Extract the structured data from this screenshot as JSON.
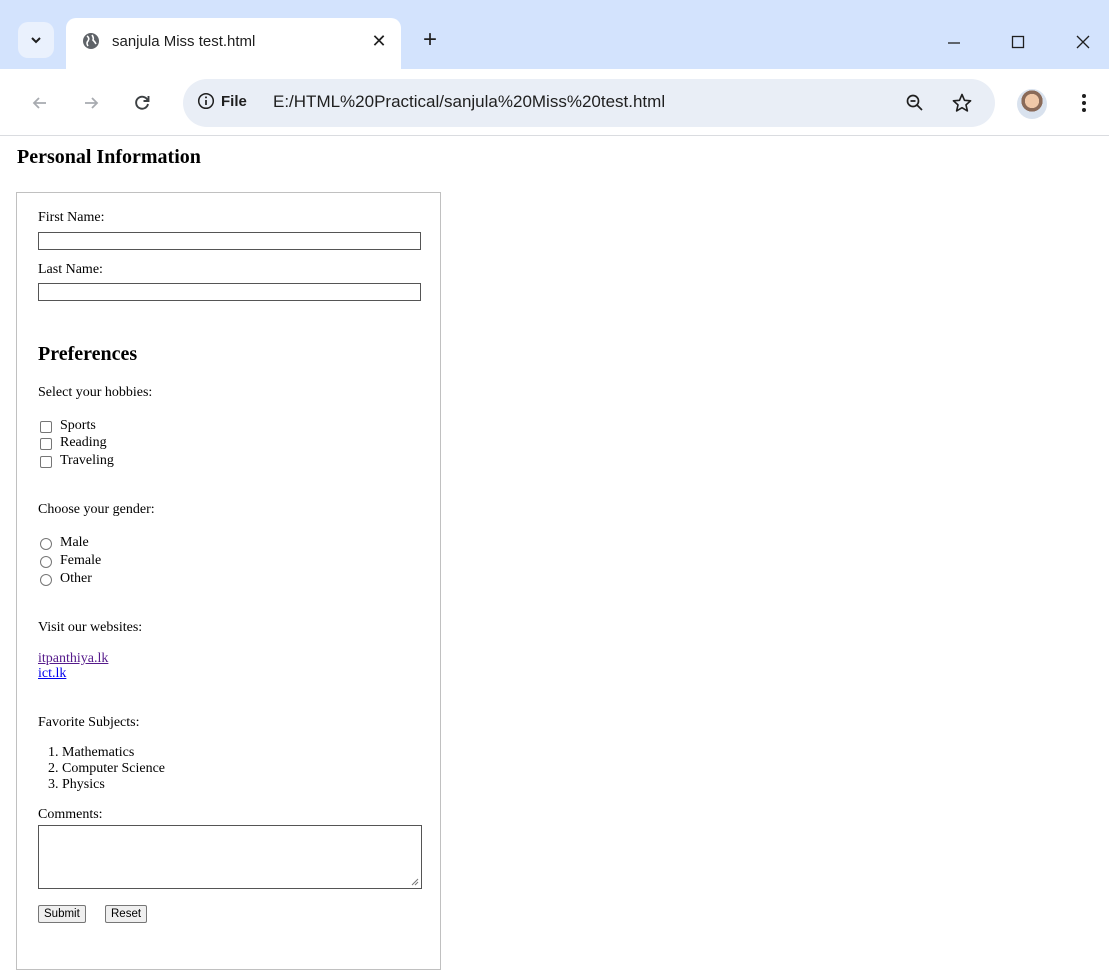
{
  "browser": {
    "tab": {
      "title": "sanjula Miss test.html",
      "close_glyph": "✕"
    },
    "new_tab_glyph": "+",
    "address": {
      "info_label": "File",
      "url": "E:/HTML%20Practical/sanjula%20Miss%20test.html"
    }
  },
  "page": {
    "heading": "Personal Information",
    "fields": {
      "first_name_label": "First Name:",
      "last_name_label": "Last Name:"
    },
    "preferences_heading": "Preferences",
    "hobbies": {
      "prompt": "Select your hobbies:",
      "options": [
        "Sports",
        "Reading",
        "Traveling"
      ]
    },
    "gender": {
      "prompt": "Choose your gender:",
      "options": [
        "Male",
        "Female",
        "Other"
      ]
    },
    "websites": {
      "prompt": "Visit our websites:",
      "links": [
        {
          "text": "itpanthiya.lk",
          "color": "#551a8b"
        },
        {
          "text": "ict.lk",
          "color": "#0000ee"
        }
      ]
    },
    "subjects": {
      "prompt": "Favorite Subjects:",
      "items": [
        "1. Mathematics",
        "2. Computer Science",
        "3. Physics"
      ]
    },
    "comments_label": "Comments:",
    "buttons": {
      "submit": "Submit",
      "reset": "Reset"
    }
  }
}
